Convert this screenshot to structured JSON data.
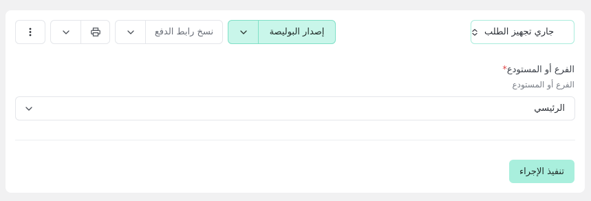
{
  "toolbar": {
    "status_select": {
      "label": "جاري تجهيز الطلب",
      "icon": "chevron-up-down-icon"
    },
    "issue_policy": {
      "label": "إصدار البوليصة",
      "caret_icon": "chevron-down-icon"
    },
    "copy_payment_link": {
      "label": "نسخ رابط الدفع",
      "caret_icon": "chevron-down-icon"
    },
    "print": {
      "icon": "printer-icon",
      "caret_icon": "chevron-down-icon"
    },
    "more": {
      "icon": "more-vertical-icon"
    }
  },
  "form": {
    "branch": {
      "label": "الفرع أو المستودع",
      "required_mark": "*",
      "hint": "الفرع أو المستودع",
      "value": "الرئيسي"
    }
  },
  "actions": {
    "execute_label": "تنفيذ الإجراء"
  },
  "colors": {
    "accent": "#a9efdd",
    "accent_border": "#7fe0c7",
    "required": "#e04a4a"
  }
}
